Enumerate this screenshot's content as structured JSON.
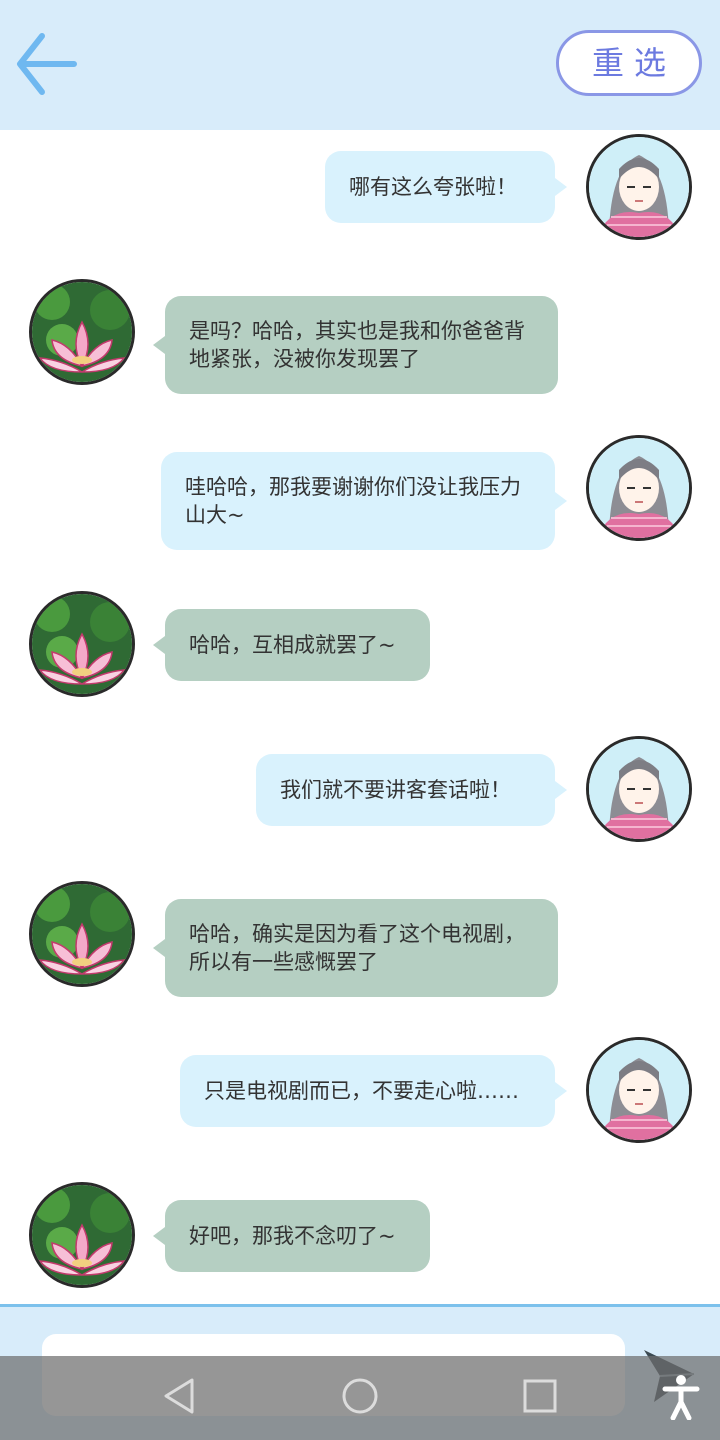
{
  "header": {
    "back_icon": "arrow-left-icon",
    "reset_label": "重选"
  },
  "messages": [
    {
      "sender": "me",
      "text": "哪有这么夸张啦！"
    },
    {
      "sender": "mom",
      "text": "是吗？哈哈，其实也是我和你爸爸背地紧张，没被你发现罢了"
    },
    {
      "sender": "me",
      "text": "哇哈哈，那我要谢谢你们没让我压力山大~"
    },
    {
      "sender": "mom",
      "text": "哈哈，互相成就罢了~"
    },
    {
      "sender": "me",
      "text": "我们就不要讲客套话啦！"
    },
    {
      "sender": "mom",
      "text": "哈哈，确实是因为看了这个电视剧，所以有一些感慨罢了"
    },
    {
      "sender": "me",
      "text": "只是电视剧而已，不要走心啦……"
    },
    {
      "sender": "mom",
      "text": "好吧，那我不念叨了~"
    }
  ],
  "avatars": {
    "me": "girl-avatar-icon",
    "mom": "lotus-avatar-icon"
  },
  "input": {
    "placeholder": "",
    "send_icon": "paper-plane-icon"
  },
  "system_nav": {
    "back_icon": "triangle-back-icon",
    "home_icon": "circle-home-icon",
    "recents_icon": "square-recents-icon",
    "accessibility_icon": "accessibility-icon"
  },
  "colors": {
    "header_bg": "#d8ecfa",
    "my_bubble": "#d9f2fd",
    "mom_bubble": "#b5cfc2",
    "accent": "#6c7ae0",
    "divider": "#7cc1ec"
  }
}
